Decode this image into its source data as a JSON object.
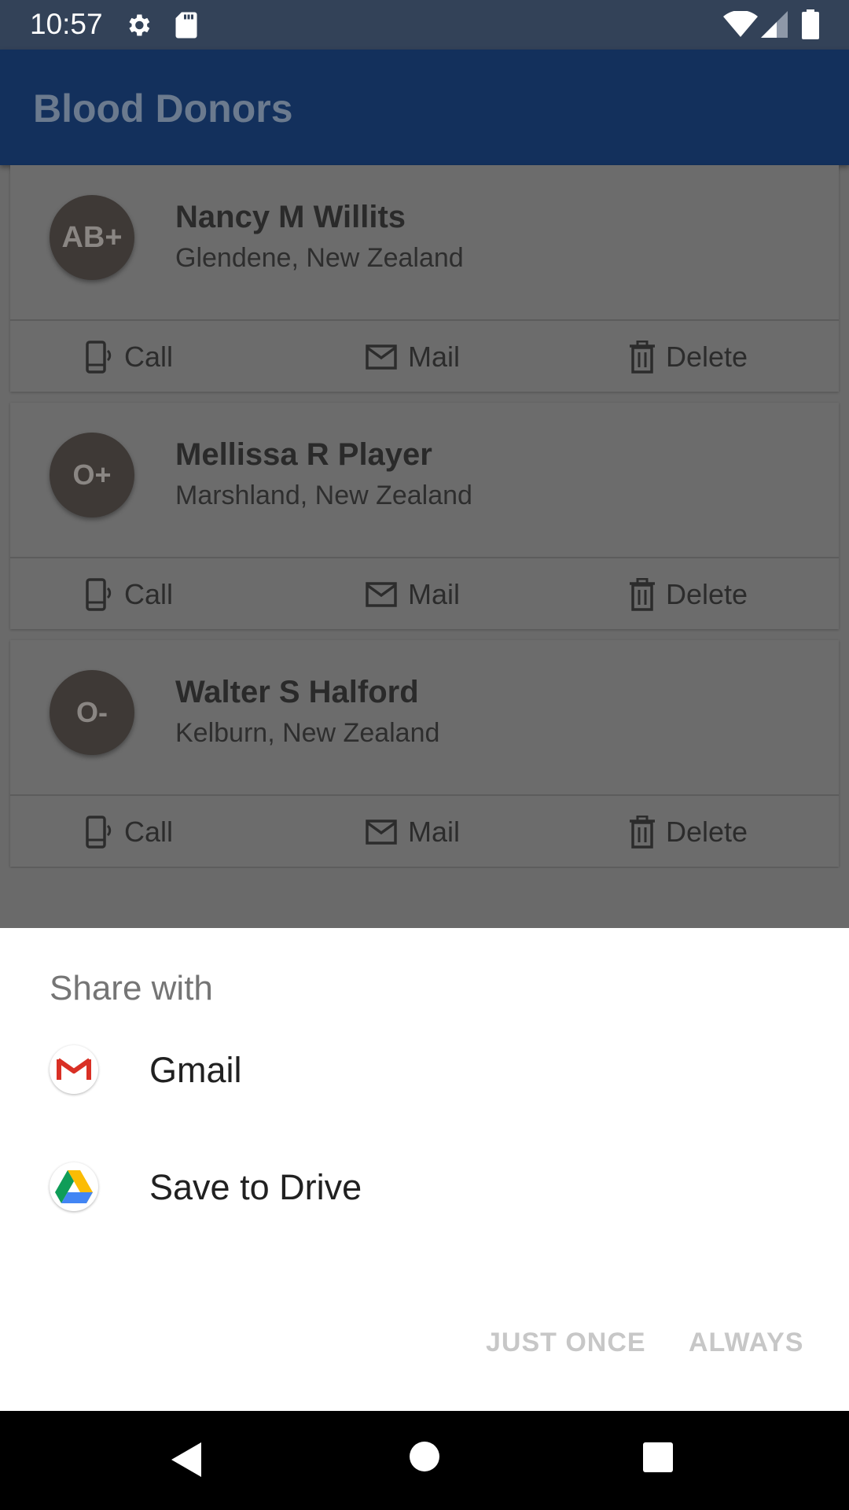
{
  "status_bar": {
    "time": "10:57"
  },
  "app_bar": {
    "title": "Blood Donors"
  },
  "donors": [
    {
      "blood_type": "AB+",
      "name": "Nancy M Willits",
      "location": "Glendene, New Zealand"
    },
    {
      "blood_type": "O+",
      "name": "Mellissa R Player",
      "location": "Marshland, New Zealand"
    },
    {
      "blood_type": "O-",
      "name": "Walter S Halford",
      "location": "Kelburn, New Zealand"
    }
  ],
  "actions": {
    "call": "Call",
    "mail": "Mail",
    "delete": "Delete"
  },
  "share_sheet": {
    "title": "Share with",
    "items": [
      {
        "label": "Gmail",
        "icon": "gmail-icon"
      },
      {
        "label": "Save to Drive",
        "icon": "drive-icon"
      }
    ],
    "just_once": "JUST ONCE",
    "always": "ALWAYS"
  },
  "colors": {
    "status_bar": "#334258",
    "app_bar": "#13305c",
    "sheet_background": "#ffffff",
    "disabled_button": "#c7c7c7"
  }
}
